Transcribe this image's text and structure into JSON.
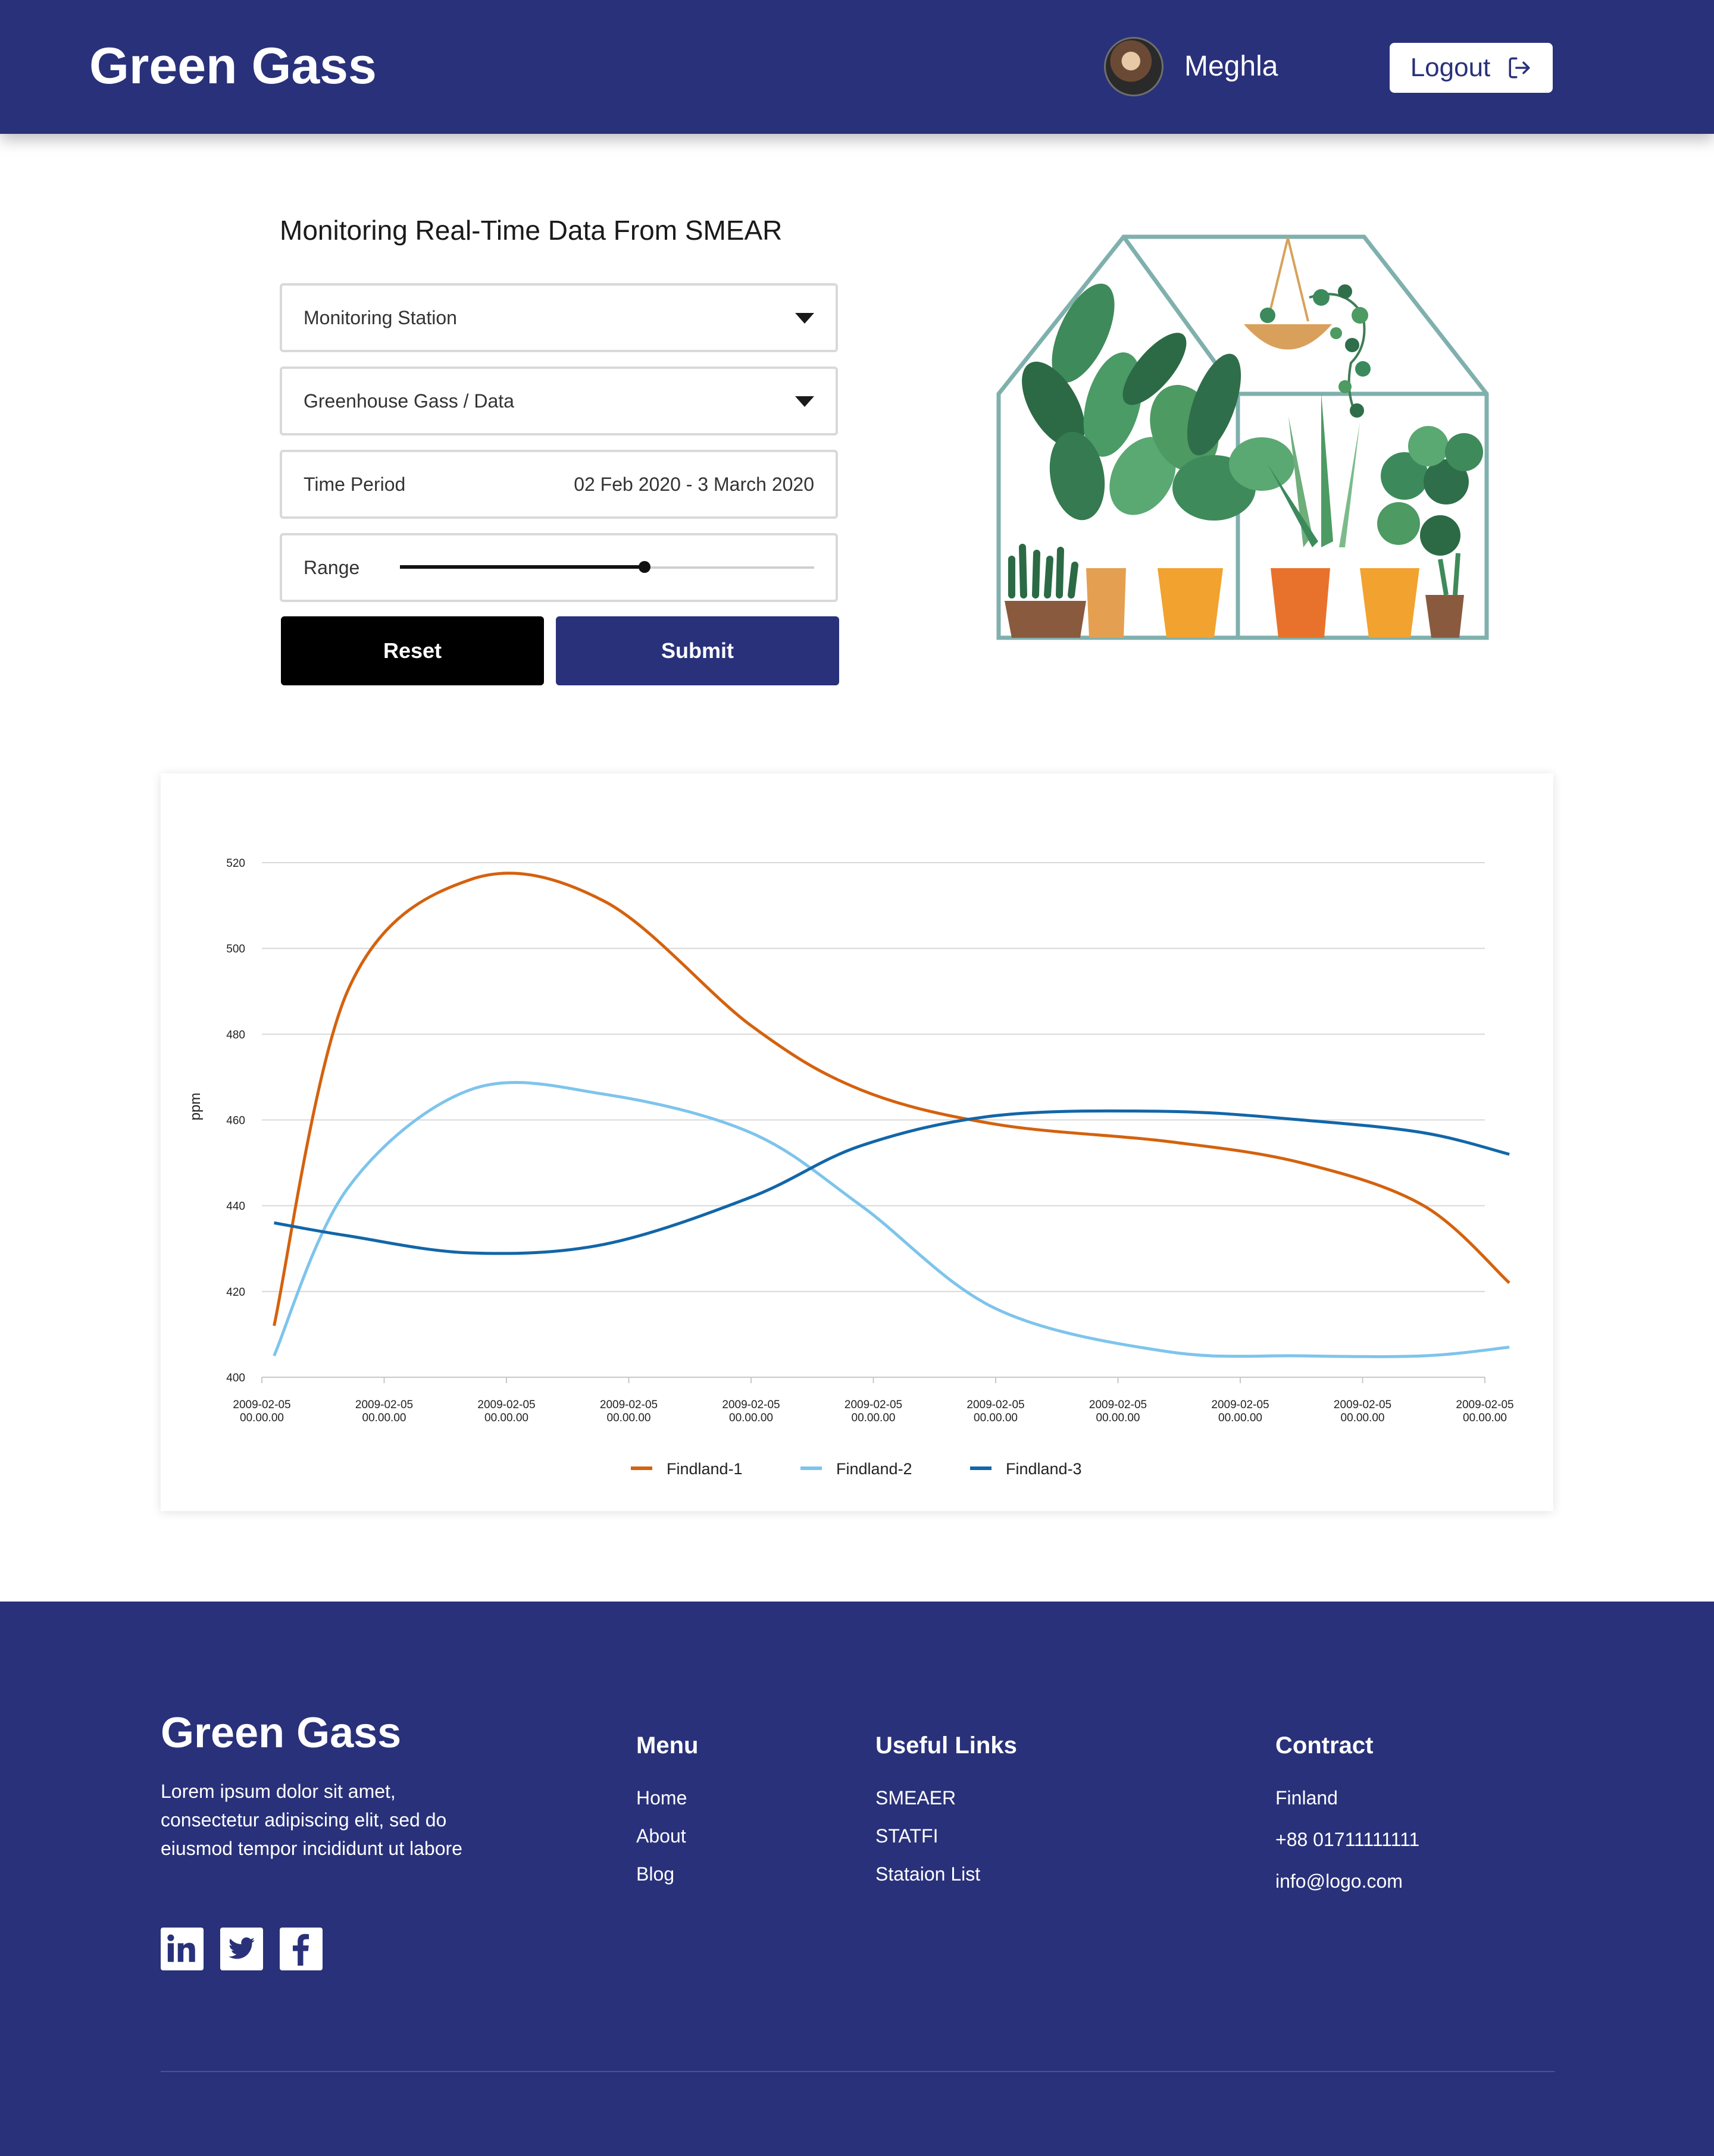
{
  "header": {
    "brand": "Green Gass",
    "user_name": "Meghla",
    "logout_label": "Logout"
  },
  "form": {
    "title": "Monitoring Real-Time Data From SMEAR",
    "station_label": "Monitoring Station",
    "gas_label": "Greenhouse Gass / Data",
    "period_label": "Time Period",
    "period_value": "02 Feb 2020 - 3 March 2020",
    "range_label": "Range",
    "range_value": 0.59,
    "reset_label": "Reset",
    "submit_label": "Submit"
  },
  "chart_data": {
    "type": "line",
    "ylabel": "ppm",
    "ylim": [
      400,
      520
    ],
    "yticks": [
      400,
      420,
      440,
      460,
      480,
      500,
      520
    ],
    "x_tick_labels": [
      [
        "2009-02-05",
        "00.00.00"
      ],
      [
        "2009-02-05",
        "00.00.00"
      ],
      [
        "2009-02-05",
        "00.00.00"
      ],
      [
        "2009-02-05",
        "00.00.00"
      ],
      [
        "2009-02-05",
        "00.00.00"
      ],
      [
        "2009-02-05",
        "00.00.00"
      ],
      [
        "2009-02-05",
        "00.00.00"
      ],
      [
        "2009-02-05",
        "00.00.00"
      ],
      [
        "2009-02-05",
        "00.00.00"
      ],
      [
        "2009-02-05",
        "00.00.00"
      ],
      [
        "2009-02-05",
        "00.00.00"
      ]
    ],
    "x": [
      0.1,
      0.7,
      1.7,
      2.8,
      4,
      4.9,
      6,
      7.4,
      8.5,
      9.5,
      10.2
    ],
    "grid": true,
    "legend_position": "bottom",
    "series": [
      {
        "name": "Findland-1",
        "color": "#d4620e",
        "values": [
          412,
          490,
          516,
          511,
          482,
          467,
          459,
          455,
          450,
          440,
          422
        ]
      },
      {
        "name": "Findland-2",
        "color": "#7ec4ec",
        "values": [
          405,
          444,
          467,
          466,
          457,
          440,
          416,
          406,
          405,
          405,
          407
        ]
      },
      {
        "name": "Findland-3",
        "color": "#1266a8",
        "values": [
          436,
          433,
          429,
          431,
          442,
          454,
          461,
          462,
          460,
          457,
          452
        ]
      }
    ]
  },
  "footer": {
    "brand": "Green Gass",
    "description": "Lorem ipsum dolor sit amet, consectetur adipiscing elit, sed do eiusmod tempor incididunt ut labore",
    "menu": {
      "title": "Menu",
      "items": [
        "Home",
        "About",
        "Blog"
      ]
    },
    "useful_links": {
      "title": "Useful Links",
      "items": [
        "SMEAER",
        "STATFI",
        "Stataion List"
      ]
    },
    "contact": {
      "title": "Contract",
      "items": [
        "Finland",
        "+88 01711111111",
        "info@logo.com"
      ]
    },
    "social_icons": [
      "linkedin-icon",
      "twitter-icon",
      "facebook-icon"
    ]
  },
  "colors": {
    "brand_navy": "#29317a",
    "reset_black": "#000000"
  }
}
